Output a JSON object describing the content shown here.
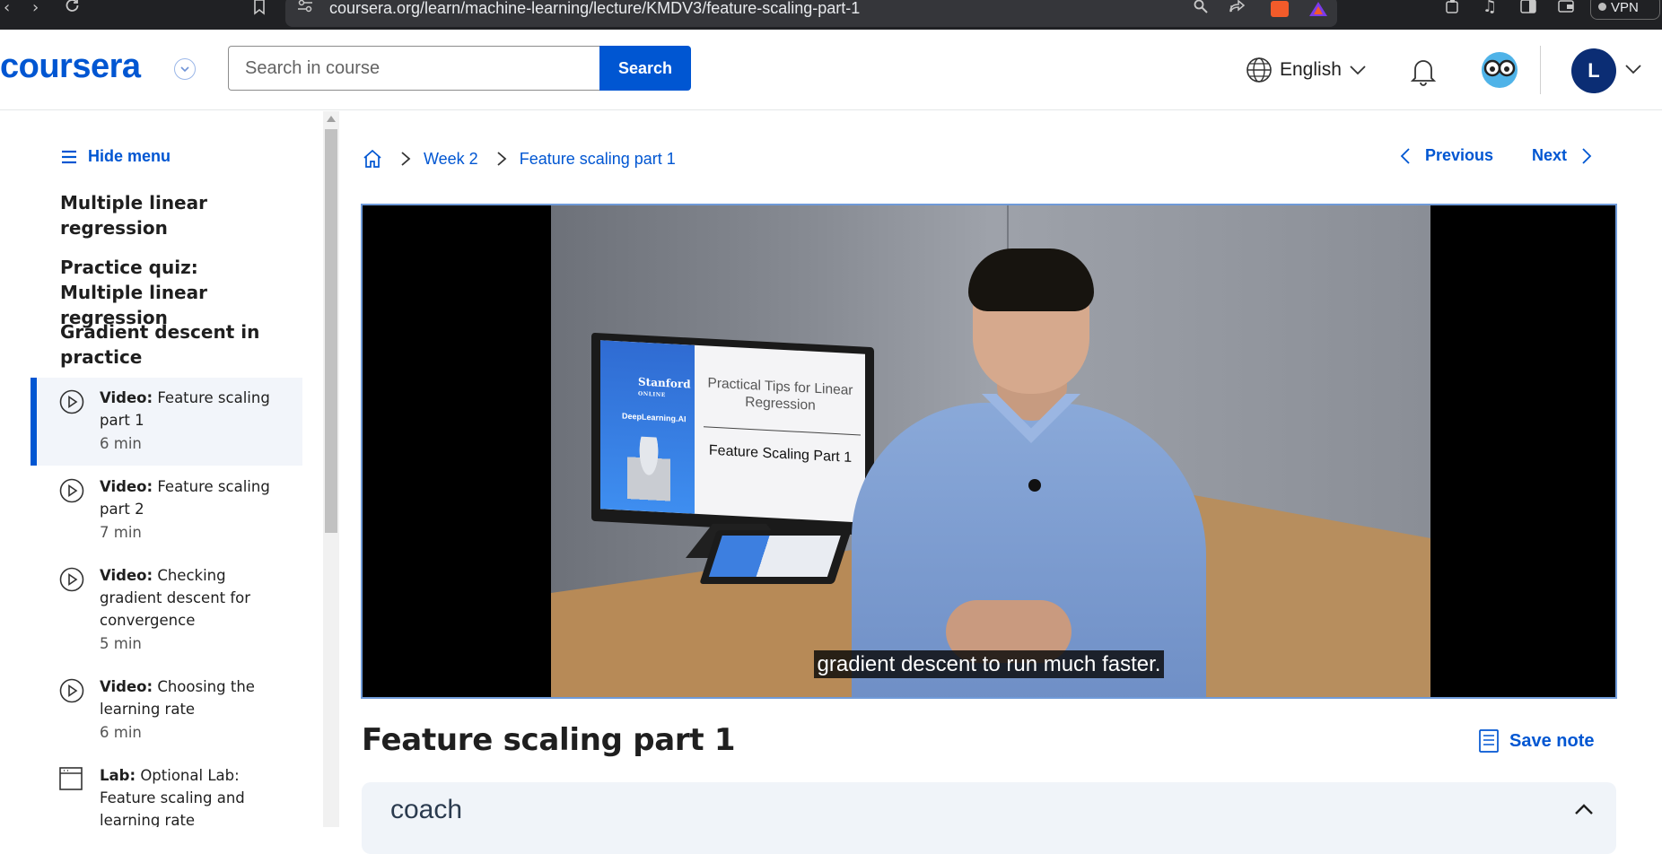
{
  "browser": {
    "url": "coursera.org/learn/machine-learning/lecture/KMDV3/feature-scaling-part-1",
    "vpn_label": "VPN"
  },
  "header": {
    "logo": "coursera",
    "search_placeholder": "Search in course",
    "search_button": "Search",
    "language": "English",
    "avatar_initial": "L"
  },
  "sidebar": {
    "hide_menu": "Hide menu",
    "sections": [
      "Multiple linear regression",
      "Practice quiz: Multiple linear regression",
      "Gradient descent in practice"
    ],
    "items": [
      {
        "type": "Video:",
        "title": "Feature scaling part 1",
        "duration": "6 min",
        "active": true
      },
      {
        "type": "Video:",
        "title": "Feature scaling part 2",
        "duration": "7 min",
        "active": false
      },
      {
        "type": "Video:",
        "title": "Checking gradient descent for convergence",
        "duration": "5 min",
        "active": false
      },
      {
        "type": "Video:",
        "title": "Choosing the learning rate",
        "duration": "6 min",
        "active": false
      },
      {
        "type": "Lab:",
        "title": "Optional Lab: Feature scaling and learning rate",
        "duration": "",
        "active": false
      }
    ]
  },
  "breadcrumb": {
    "week": "Week 2",
    "current": "Feature scaling part 1"
  },
  "nav": {
    "previous": "Previous",
    "next": "Next"
  },
  "video": {
    "slide_brand": "Stanford",
    "slide_brand_sub": "ONLINE",
    "slide_partner": "DeepLearning.AI",
    "slide_title": "Practical Tips for Linear Regression",
    "slide_subtitle": "Feature Scaling Part 1",
    "caption": "gradient descent to run much faster."
  },
  "lecture": {
    "title": "Feature scaling part 1",
    "save_note": "Save note"
  },
  "coach": {
    "label": "coach"
  },
  "colors": {
    "brand": "#0056d2",
    "text": "#1f1f1f",
    "active_bg": "#f2f5fa",
    "avatar_bg": "#0b2d74"
  }
}
